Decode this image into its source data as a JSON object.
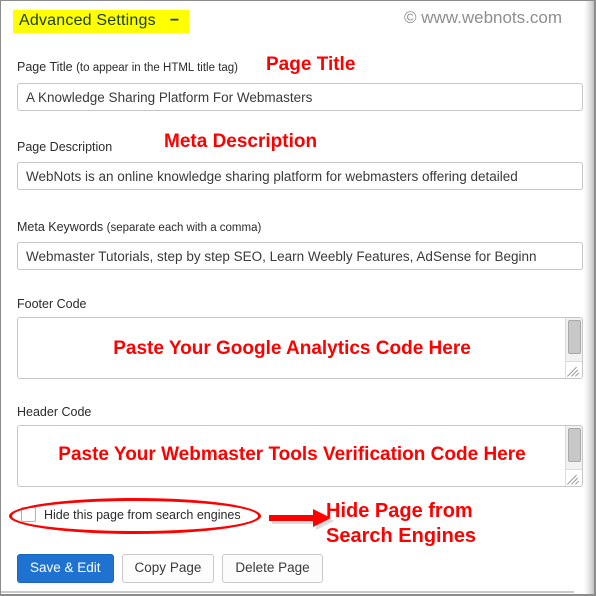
{
  "window": {
    "section_title": "Advanced Settings",
    "collapse_glyph": "−",
    "watermark": "© www.webnots.com"
  },
  "fields": {
    "page_title": {
      "label": "Page Title",
      "hint": "(to appear in the HTML title tag)",
      "annotation": "Page Title",
      "value": "A Knowledge Sharing Platform For Webmasters"
    },
    "page_description": {
      "label": "Page Description",
      "hint": "",
      "annotation": "Meta Description",
      "value": "WebNots is an online knowledge sharing platform for webmasters offering detailed"
    },
    "meta_keywords": {
      "label": "Meta Keywords",
      "hint": "(separate each with a comma)",
      "annotation": "",
      "value": "Webmaster Tutorials, step by step SEO, Learn Weebly Features, AdSense for Beginn"
    },
    "footer_code": {
      "label": "Footer Code",
      "annotation": "Paste Your Google Analytics Code Here",
      "value": ""
    },
    "header_code": {
      "label": "Header Code",
      "annotation": "Paste Your Webmaster Tools Verification Code Here",
      "value": ""
    }
  },
  "hide_page": {
    "checkbox_label": "Hide this page from search engines",
    "checked": false,
    "annotation_line1": "Hide Page from",
    "annotation_line2": "Search Engines"
  },
  "buttons": {
    "save": "Save & Edit",
    "copy": "Copy Page",
    "delete": "Delete Page"
  },
  "colors": {
    "highlight": "#ffff00",
    "annotation_red": "#fe0000",
    "primary_button": "#1f72d0",
    "watermark_gray": "#8e8e8e",
    "field_border": "#c6c6c6"
  }
}
